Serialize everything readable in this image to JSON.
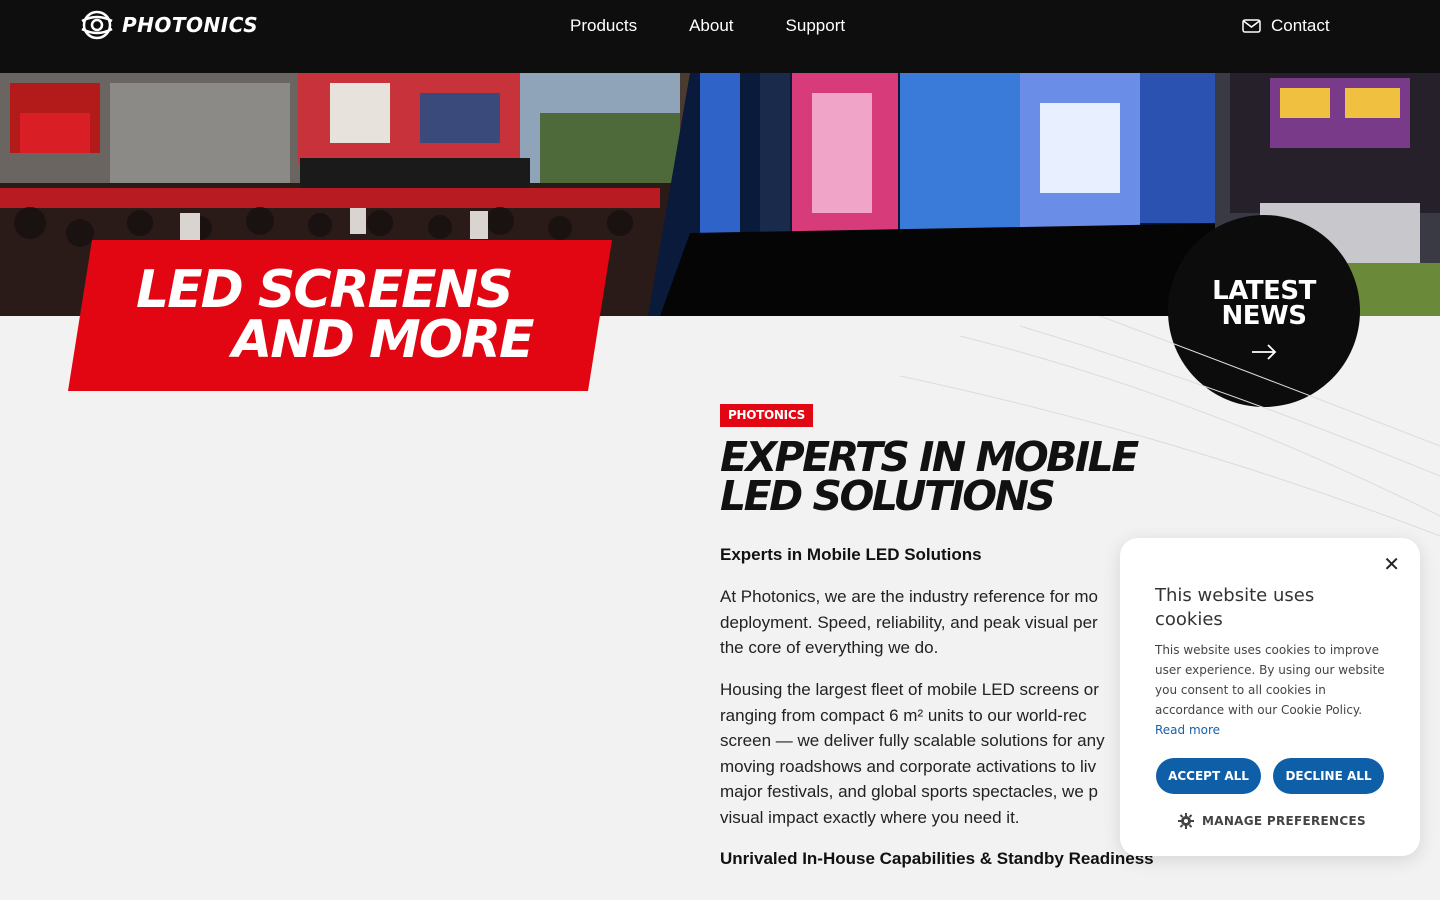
{
  "header": {
    "logo_text": "PHOTONICS",
    "nav": [
      "Products",
      "About",
      "Support"
    ],
    "contact_label": "Contact"
  },
  "banner": {
    "line1": "LED SCREENS",
    "line2": "AND MORE"
  },
  "news": {
    "label_line1": "LATEST",
    "label_line2": "NEWS"
  },
  "content": {
    "tag": "PHOTONICS",
    "heading_line1": "EXPERTS IN MOBILE",
    "heading_line2": "LED SOLUTIONS",
    "subheading": "Experts in Mobile LED Solutions",
    "paragraph1": [
      "At Photonics, we are the industry reference for mo",
      "deployment. Speed, reliability, and peak visual per",
      "the core of everything we do."
    ],
    "paragraph2": [
      "Housing the largest fleet of mobile LED screens or",
      "ranging from compact 6 m² units to our world-rec",
      "screen — we deliver fully scalable solutions for any",
      "moving roadshows and corporate activations to liv",
      "major festivals, and global sports spectacles, we p",
      "visual impact exactly where you need it."
    ],
    "subheading2": "Unrivaled In-House Capabilities & Standby Readiness"
  },
  "cookie": {
    "title": "This website uses cookies",
    "body": "This website uses cookies to improve user experience. By using our website you consent to all cookies in accordance with our Cookie Policy.",
    "read_more": "Read more",
    "accept": "ACCEPT ALL",
    "decline": "DECLINE ALL",
    "manage": "MANAGE PREFERENCES"
  },
  "colors": {
    "brand_red": "#e20613",
    "header_bg": "#0e0e0e",
    "button_blue": "#0f5fa8"
  }
}
